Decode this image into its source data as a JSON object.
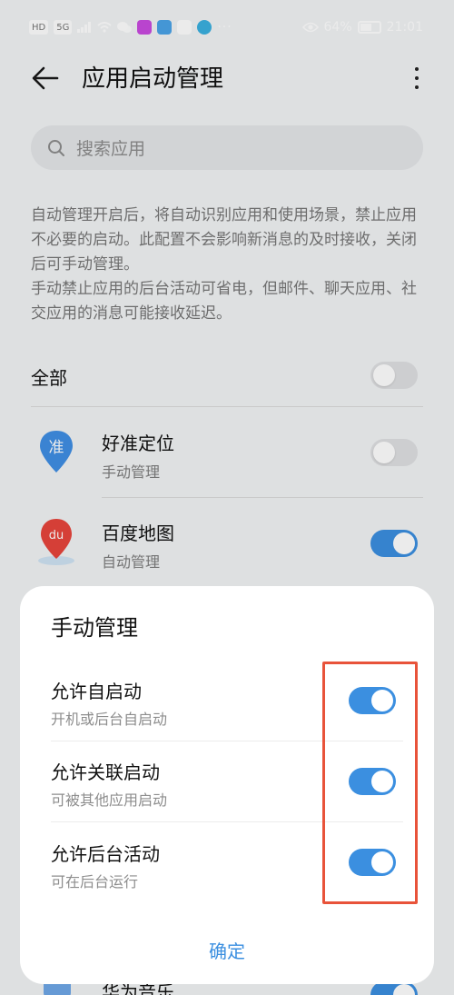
{
  "status_bar": {
    "indicators": [
      "HD",
      "5G"
    ],
    "dots": "···",
    "battery": "64%",
    "battery_level": 0.64,
    "time": "21:01"
  },
  "header": {
    "title": "应用启动管理",
    "back_icon": "arrow-left-icon",
    "more_icon": "more-vertical-icon"
  },
  "search": {
    "placeholder": "搜索应用",
    "icon": "search-icon"
  },
  "description": {
    "para1": "自动管理开启后，将自动识别应用和使用场景，禁止应用不必要的启动。此配置不会影响新消息的及时接收，关闭后可手动管理。",
    "para2": "手动禁止应用的后台活动可省电，但邮件、聊天应用、社交应用的消息可能接收延迟。"
  },
  "all_row": {
    "label": "全部",
    "toggle_on": false
  },
  "apps": [
    {
      "name": "好准定位",
      "mode": "手动管理",
      "toggle_on": false,
      "icon": "location-pin-icon",
      "icon_text": "准"
    },
    {
      "name": "百度地图",
      "mode": "自动管理",
      "toggle_on": true,
      "icon": "map-pin-icon",
      "icon_text": "du"
    },
    {
      "name": "华为音乐",
      "toggle_on": true,
      "icon": "music-icon"
    }
  ],
  "dialog": {
    "title": "手动管理",
    "options": [
      {
        "label": "允许自启动",
        "sub": "开机或后台自启动",
        "toggle_on": true
      },
      {
        "label": "允许关联启动",
        "sub": "可被其他应用启动",
        "toggle_on": true
      },
      {
        "label": "允许后台活动",
        "sub": "可在后台运行",
        "toggle_on": true
      }
    ],
    "confirm": "确定"
  },
  "colors": {
    "accent": "#3b8fe0",
    "highlight": "#e8533a",
    "toggle_off": "#dfe0e2",
    "background": "#f1f3f5"
  }
}
